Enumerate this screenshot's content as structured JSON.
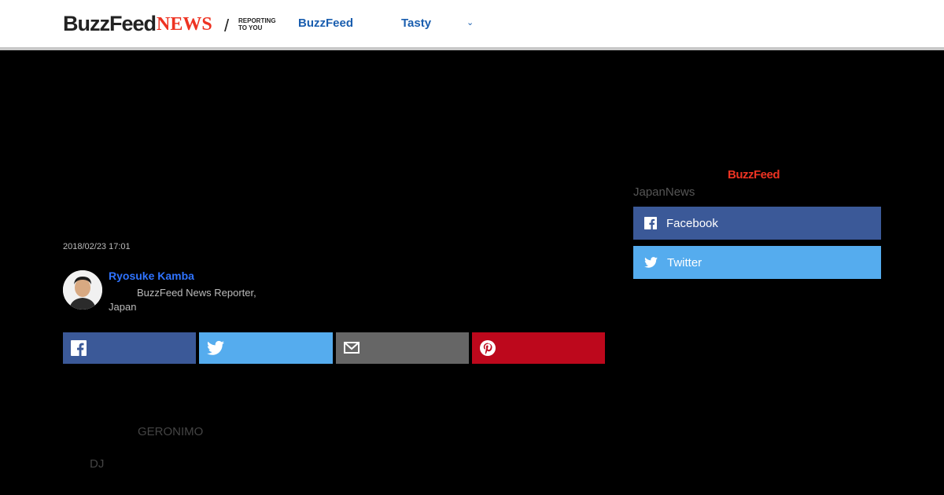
{
  "header": {
    "logo_buzzfeed": "BuzzFeed",
    "logo_news": "NEWS",
    "logo_slash": "/",
    "tagline": "REPORTING TO YOU",
    "nav_buzzfeed": "BuzzFeed",
    "nav_tasty": "Tasty",
    "nav_chevron": "⌄"
  },
  "article": {
    "date": "2018/02/23 17:01",
    "author_name": "Ryosuke Kamba",
    "author_role": "BuzzFeed News Reporter, Japan",
    "share_buttons": [
      "facebook-icon",
      "twitter-icon",
      "mail-icon",
      "pinterest-icon"
    ],
    "body_text_1": "GERONIMO",
    "body_text_2": "DJ"
  },
  "sidebar": {
    "logo": "BuzzFeed",
    "title": "JapanNews",
    "facebook_label": "Facebook",
    "twitter_label": "Twitter"
  },
  "colors": {
    "facebook": "#3b5998",
    "twitter": "#55acee",
    "mail": "#666666",
    "pinterest": "#bd081c",
    "brand_red": "#ee3322",
    "link_blue": "#1a5eaf"
  }
}
